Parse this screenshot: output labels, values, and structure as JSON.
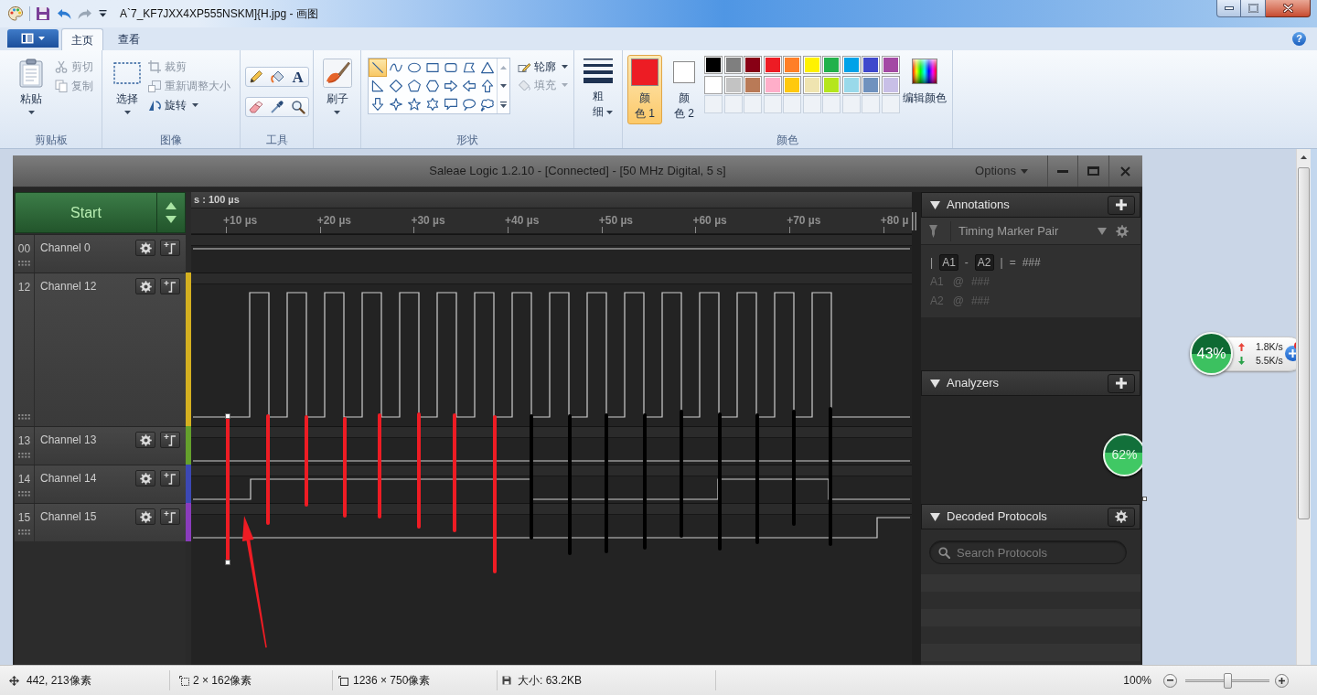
{
  "title_bar": {
    "title": "A`7_KF7JXX4XP555NSKM]{H.jpg - 画图"
  },
  "ribbon_tabs": [
    {
      "label": "主页",
      "selected": true
    },
    {
      "label": "查看",
      "selected": false
    }
  ],
  "help_button": {
    "glyph": "?"
  },
  "clipboard_group": {
    "label": "剪贴板",
    "paste": "粘贴",
    "commands": [
      {
        "kind": "cut",
        "label": "剪切",
        "disabled": true
      },
      {
        "kind": "copy",
        "label": "复制",
        "disabled": true
      }
    ]
  },
  "image_group": {
    "label": "图像",
    "select": "选择",
    "commands": [
      {
        "kind": "crop",
        "label": "裁剪",
        "disabled": true
      },
      {
        "kind": "resize",
        "label": "重新调整大小",
        "disabled": true
      },
      {
        "kind": "rotate",
        "label": "旋转",
        "disabled": false
      }
    ]
  },
  "tools_group": {
    "label": "工具",
    "tools": [
      {
        "kind": "pencil"
      },
      {
        "kind": "fill"
      },
      {
        "kind": "text",
        "glyph": "A"
      },
      {
        "kind": "eraser"
      },
      {
        "kind": "picker"
      },
      {
        "kind": "magnifier"
      }
    ]
  },
  "brushes": {
    "label": "刷子"
  },
  "shapes_group": {
    "label": "形状",
    "shapes": [
      {
        "kind": "line",
        "selected": true
      },
      {
        "kind": "curve",
        "selected": false
      },
      {
        "kind": "oval",
        "selected": false
      },
      {
        "kind": "rectangle",
        "selected": false
      },
      {
        "kind": "rounded_rectangle",
        "selected": false
      },
      {
        "kind": "polygon",
        "selected": false
      },
      {
        "kind": "triangle",
        "selected": false
      },
      {
        "kind": "right_triangle",
        "selected": false
      },
      {
        "kind": "diamond",
        "selected": false
      },
      {
        "kind": "pentagon",
        "selected": false
      },
      {
        "kind": "hexagon",
        "selected": false
      },
      {
        "kind": "right_arrow",
        "selected": false
      },
      {
        "kind": "left_arrow",
        "selected": false
      },
      {
        "kind": "up_arrow",
        "selected": false
      },
      {
        "kind": "down_arrow",
        "selected": false
      },
      {
        "kind": "star4",
        "selected": false
      },
      {
        "kind": "star5",
        "selected": false
      },
      {
        "kind": "star6",
        "selected": false
      },
      {
        "kind": "rect_callout",
        "selected": false
      },
      {
        "kind": "oval_callout",
        "selected": false
      },
      {
        "kind": "cloud_callout",
        "selected": false
      }
    ],
    "options": [
      {
        "kind": "outline",
        "label": "轮廓",
        "disabled": false
      },
      {
        "kind": "fill",
        "label": "填充",
        "disabled": true
      }
    ]
  },
  "size": {
    "label": "粗细"
  },
  "colors_group": {
    "label": "颜色",
    "active": [
      {
        "label": "颜色 1",
        "color": "#ed1c24",
        "selected": true
      },
      {
        "label": "颜色 2",
        "color": "#ffffff",
        "selected": false
      }
    ],
    "palette": [
      {
        "color": "#000000"
      },
      {
        "color": "#7f7f7f"
      },
      {
        "color": "#880015"
      },
      {
        "color": "#ed1c24"
      },
      {
        "color": "#ff7f27"
      },
      {
        "color": "#fff200"
      },
      {
        "color": "#22b14c"
      },
      {
        "color": "#00a2e8"
      },
      {
        "color": "#3f48cc"
      },
      {
        "color": "#a349a4"
      },
      {
        "color": "#ffffff"
      },
      {
        "color": "#c3c3c3"
      },
      {
        "color": "#b97a57"
      },
      {
        "color": "#ffaec9"
      },
      {
        "color": "#ffc90e"
      },
      {
        "color": "#efe4b0"
      },
      {
        "color": "#b5e61d"
      },
      {
        "color": "#99d9ea"
      },
      {
        "color": "#7092be"
      },
      {
        "color": "#c8bfe7"
      }
    ],
    "edit": "编辑颜色"
  },
  "logic_window": {
    "title": "Saleae Logic 1.2.10 - [Connected] - [50 MHz Digital, 5 s]",
    "options": "Options",
    "start": "Start",
    "timeline": {
      "range": "s : 100 µs",
      "ticks": [
        "+10 µs",
        "+20 µs",
        "+30 µs",
        "+40 µs",
        "+50 µs",
        "+60 µs",
        "+70 µs",
        "+80 µ"
      ]
    },
    "channels": [
      {
        "number": "00",
        "name": "Channel 0",
        "expanded": false
      },
      {
        "number": "12",
        "name": "Channel 12",
        "expanded": true,
        "color": "#d4b020"
      },
      {
        "number": "13",
        "name": "Channel 13",
        "expanded": false,
        "color": "#64a02c"
      },
      {
        "number": "14",
        "name": "Channel 14",
        "expanded": false,
        "color": "#3c48b4"
      },
      {
        "number": "15",
        "name": "Channel 15",
        "expanded": false,
        "color": "#8a3cbc"
      }
    ],
    "annotations": {
      "title": "Annotations",
      "marker_pair": "Timing Marker Pair",
      "formula": [
        {
          "kind": "text",
          "text": "|"
        },
        {
          "kind": "marker",
          "text": "A1"
        },
        {
          "kind": "text",
          "text": "-"
        },
        {
          "kind": "marker",
          "text": "A2"
        },
        {
          "kind": "text",
          "text": "|"
        },
        {
          "kind": "text",
          "text": "="
        },
        {
          "kind": "text",
          "text": "###"
        }
      ],
      "positions": [
        {
          "marker": "A1",
          "at": "@",
          "value": "###"
        },
        {
          "marker": "A2",
          "at": "@",
          "value": "###"
        }
      ]
    },
    "analyzers": {
      "title": "Analyzers"
    },
    "decoded_protocols": {
      "title": "Decoded Protocols",
      "search": {
        "placeholder": "Search Protocols"
      }
    },
    "memory_badge": "62%"
  },
  "net_widget": {
    "percent": "43%",
    "upload": "1.8K/s",
    "download": "5.5K/s"
  },
  "status_bar": {
    "cursor": "442, 213像素",
    "selection": "2 × 162像素",
    "image_size": "1236 × 750像素",
    "file_size": "大小: 63.2KB",
    "zoom": "100%",
    "zoom_slider": {
      "level": 0.5
    }
  }
}
